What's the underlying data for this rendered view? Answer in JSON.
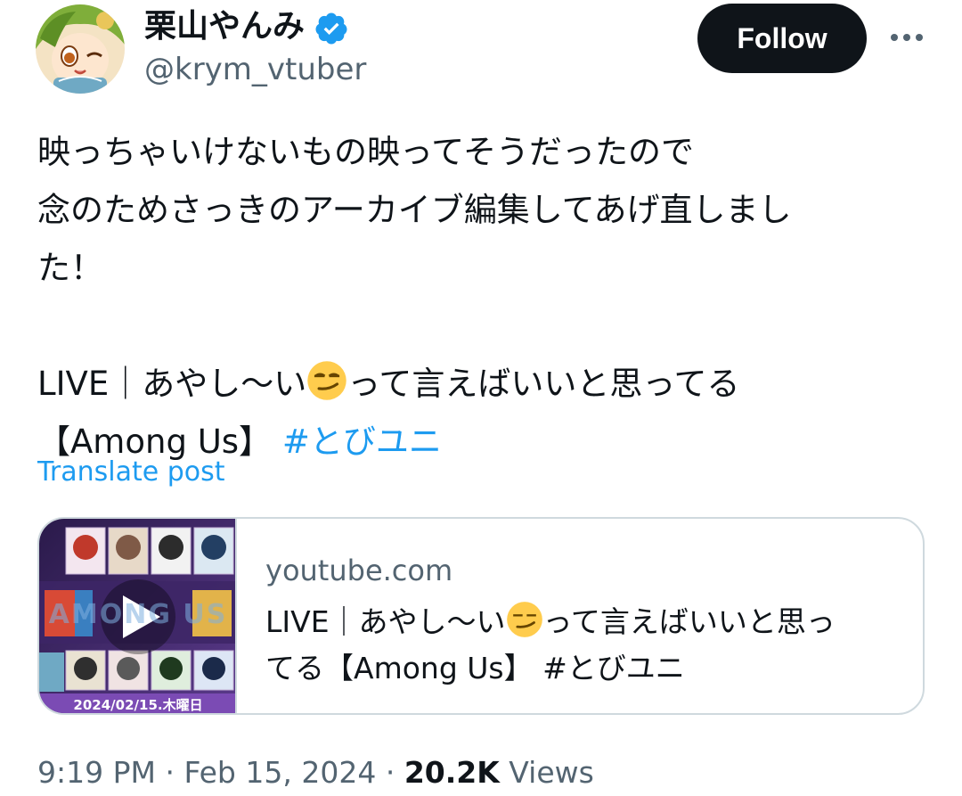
{
  "author": {
    "display_name": "栗山やんみ",
    "handle": "@krym_vtuber",
    "verified": true
  },
  "follow_button": "Follow",
  "more_icon": "more-horizontal-icon",
  "tweet": {
    "lines": [
      "映っちゃいけないもの映ってそうだったので",
      "念のためさっきのアーカイブ編集してあげ直しまし",
      "た！"
    ],
    "live_title_before_emoji": "LIVE｜あやし〜い",
    "live_title_after_emoji": "って言えばいいと思ってる",
    "bracket_title": "【Among Us】",
    "hashtag": "#とびユニ",
    "emoji": "smirking-face-emoji"
  },
  "translate_link": "Translate post",
  "link_card": {
    "domain": "youtube.com",
    "title_line1_before_emoji": "LIVE｜あやし〜い",
    "title_line1_after_emoji": "って言えばいいと思っ",
    "title_line2": "てる【Among Us】 #とびユニ",
    "thumbnail_date": "2024/02/15.木曜日",
    "thumbnail_logo_text": "AMONG US"
  },
  "meta": {
    "time": "9:19 PM",
    "sep1": " · ",
    "date": "Feb 15, 2024",
    "sep2": " · ",
    "views_count": "20.2K",
    "views_label": " Views"
  },
  "colors": {
    "link_blue": "#1d9bf0",
    "text_primary": "#0f1419",
    "text_secondary": "#536471",
    "border": "#cfd9de",
    "verified_blue": "#1d9bf0",
    "follow_bg": "#0f1419"
  }
}
